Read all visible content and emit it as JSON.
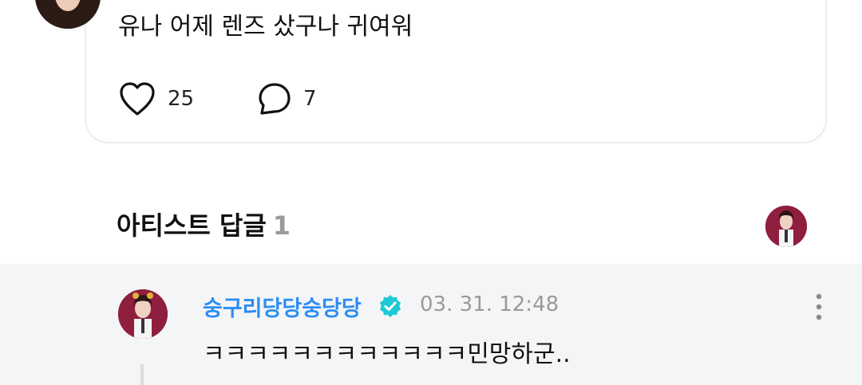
{
  "post": {
    "text": "유나 어제 렌즈 샀구나 귀여워",
    "like_count": "25",
    "comment_count": "7"
  },
  "artist_reply_section": {
    "title": "아티스트 답글",
    "count": "1"
  },
  "reply": {
    "author": "숭구리당당숭당당",
    "timestamp": "03. 31. 12:48",
    "text": "ㅋㅋㅋㅋㅋㅋㅋㅋㅋㅋㅋㅋ민망하군.."
  },
  "colors": {
    "accent_blue": "#2c8df4",
    "verified_badge": "#1fc8d6",
    "reply_background": "#f4f5f7"
  },
  "icons": [
    "heart-icon",
    "comment-bubble-icon",
    "verified-badge-icon",
    "more-vertical-icon"
  ]
}
